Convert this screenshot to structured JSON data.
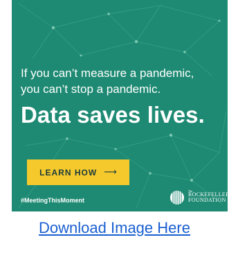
{
  "banner": {
    "line1": "If you can’t measure a pandemic,",
    "line2": "you can’t stop a pandemic.",
    "headline": "Data saves lives.",
    "cta_label": "LEARN HOW",
    "cta_arrow": "⟶",
    "hashtag": "#MeetingThisMoment",
    "logo_small": "The",
    "logo_line1": "ROCKEFELLER",
    "logo_line2": "FOUNDATION",
    "colors": {
      "background": "#1e8a73",
      "button": "#f5c92c",
      "text": "#ffffff"
    }
  },
  "download_link": "Download Image Here"
}
